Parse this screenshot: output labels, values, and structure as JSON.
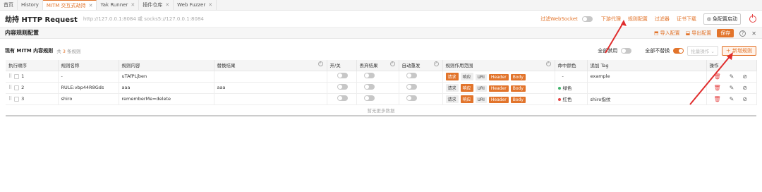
{
  "tabs": [
    {
      "label": "首页",
      "active": false,
      "closable": false
    },
    {
      "label": "History",
      "active": false,
      "closable": false
    },
    {
      "label": "MITM 交互式劫持",
      "active": true,
      "closable": true
    },
    {
      "label": "Yak Runner",
      "active": false,
      "closable": true
    },
    {
      "label": "插件仓库",
      "active": false,
      "closable": true
    },
    {
      "label": "Web Fuzzer",
      "active": false,
      "closable": true
    }
  ],
  "header": {
    "title": "劫持 HTTP Request",
    "url": "http://127.0.0.1:8084 或 socks5://127.0.0.1:8084",
    "filter_websocket": "过滤WebSocket",
    "downstream_proxy": "下游代理",
    "rule_config": "规则配置",
    "filter": "过滤器",
    "cert_download": "证书下载",
    "no_config_start": "免配置启动"
  },
  "subheader": {
    "title": "内容规则配置",
    "import": "导入配置",
    "export": "导出配置",
    "save": "保存"
  },
  "toolbar": {
    "title": "现有 MITM 内容规则",
    "count_prefix": "共",
    "count": "3",
    "count_suffix": "条规则",
    "disable_all": "全部禁用",
    "no_replace_all": "全部不替换",
    "batch_ops": "批量操作",
    "add_rule": "新增规则"
  },
  "table": {
    "columns": [
      "执行顺序",
      "规则名称",
      "规则内容",
      "替换结果",
      "开/关",
      "丢弃结果",
      "自动重发",
      "规则作用范围",
      "命中颜色",
      "追加 Tag",
      "操作"
    ],
    "scope_tags": [
      "请求",
      "响应",
      "URI",
      "Header",
      "Body"
    ],
    "rows": [
      {
        "order": "1",
        "name": "-",
        "content": "uTAfPLjben",
        "replace": "",
        "enabled": false,
        "drop": false,
        "resend": false,
        "scope": [
          true,
          false,
          false,
          true,
          true
        ],
        "color_name": "-",
        "color": "",
        "tag": "example"
      },
      {
        "order": "2",
        "name": "RULE:vbp44R8Gds",
        "content": "aaa",
        "replace": "aaa",
        "enabled": false,
        "drop": false,
        "resend": false,
        "scope": [
          false,
          true,
          false,
          true,
          true
        ],
        "color_name": "绿色",
        "color": "#3fb36b",
        "tag": ""
      },
      {
        "order": "3",
        "name": "shiro",
        "content": "rememberMe=delete",
        "replace": "",
        "enabled": false,
        "drop": false,
        "resend": false,
        "scope": [
          false,
          true,
          false,
          true,
          true
        ],
        "color_name": "红色",
        "color": "#e54545",
        "tag": "shiro指纹"
      }
    ],
    "no_more": "暂无更多数据"
  },
  "colors": {
    "accent": "#e2742b",
    "annotation": "#e02d2d"
  }
}
